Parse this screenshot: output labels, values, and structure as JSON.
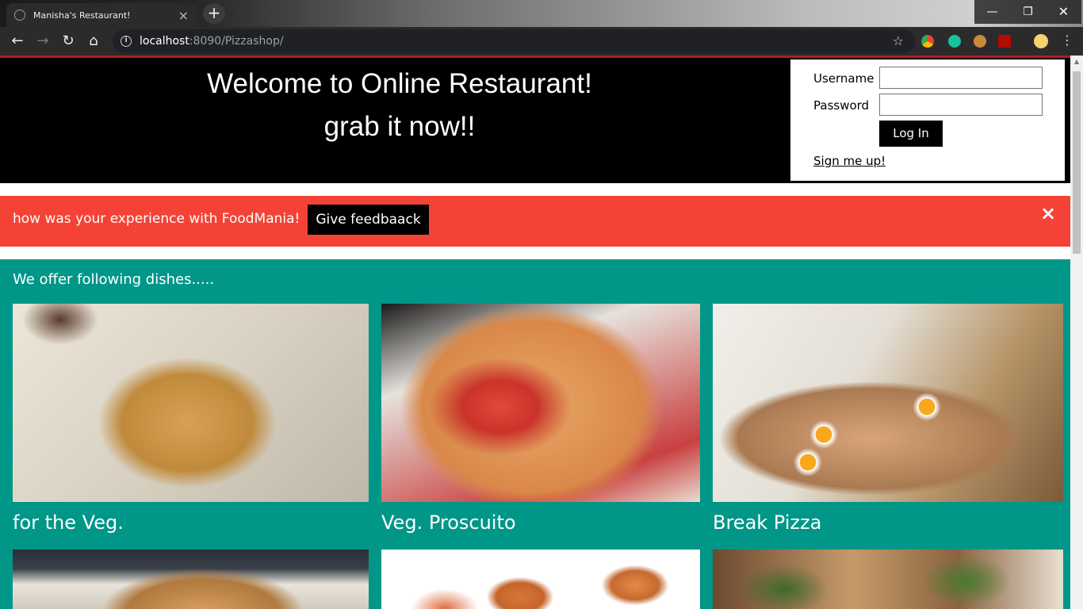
{
  "browser": {
    "tab_title": "Manisha's Restaurant!",
    "tab_close": "×",
    "new_tab": "+",
    "url_host": "localhost",
    "url_rest": ":8090/Pizzashop/",
    "info_glyph": "i",
    "star_glyph": "☆",
    "back_glyph": "←",
    "forward_glyph": "→",
    "reload_glyph": "↻",
    "home_glyph": "⌂",
    "minimize_glyph": "—",
    "maximize_glyph": "❐",
    "close_glyph": "✕",
    "menu_glyph": "⋮",
    "extensions": [
      "chrome-icon",
      "grammarly-icon",
      "cookie-icon",
      "pdf-icon",
      "profile-avatar"
    ]
  },
  "header": {
    "welcome_line1": "Welcome to Online Restaurant!",
    "welcome_line2": "grab it now!!"
  },
  "login": {
    "username_label": "Username",
    "password_label": "Password",
    "username_value": "",
    "password_value": "",
    "login_button": "Log In",
    "signup_link": "Sign me up!"
  },
  "feedback": {
    "text": "how was your experience with FoodMania!",
    "button": "Give feedbaack",
    "close": "×"
  },
  "dishes": {
    "intro": "We offer following dishes.....",
    "items": [
      {
        "name": "for the Veg."
      },
      {
        "name": "Veg. Proscuito"
      },
      {
        "name": "Break Pizza"
      },
      {
        "name": ""
      },
      {
        "name": ""
      },
      {
        "name": ""
      }
    ]
  },
  "colors": {
    "header_bg": "#000000",
    "feedback_bg": "#f44336",
    "dishes_bg": "#009688",
    "browser_dark": "#2b2b2b"
  }
}
